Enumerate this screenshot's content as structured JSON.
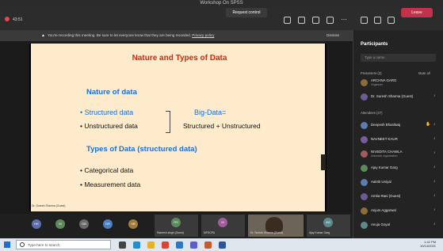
{
  "window": {
    "title": "Workshop On SPSS"
  },
  "toolbar": {
    "timer": "43:51",
    "request_control": "Request control",
    "leave": "Leave"
  },
  "banner": {
    "message": "You're recording this meeting. Be sure to let everyone know that they are being recorded.",
    "privacy_link": "Privacy policy",
    "dismiss": "Dismiss"
  },
  "slide": {
    "title": "Nature and Types of Data",
    "nature_heading": "Nature of data",
    "bullet_structured": "• Structured data",
    "bullet_unstructured": "• Unstructured data",
    "bigdata_label": "Big-Data=",
    "bigdata_formula": "Structured + Unstructured",
    "types_heading": "Types of Data (structured data)",
    "bullet_categorical": "• Categorical data",
    "bullet_measurement": "• Measurement data",
    "speaker_tag": "Dr. Suresh Sharma (Guest)"
  },
  "participants_panel": {
    "title": "Participants",
    "search_placeholder": "Type a name",
    "presenters_header": "Presenters (2)",
    "mute_all": "Mute all",
    "attendees_header": "Attendees (47)",
    "presenters": [
      {
        "initials": "AS",
        "name": "ARCHNA GARG",
        "sub": "Organizer",
        "color": "#8a6d3b"
      },
      {
        "initials": "DS",
        "name": "Dr. Suresh Sharma (Guest)",
        "sub": "",
        "color": "#6b5b95"
      }
    ],
    "attendees": [
      {
        "initials": "DB",
        "name": "Deepesh Bhardwaj",
        "sub": "",
        "color": "#5b7db1"
      },
      {
        "initials": "NK",
        "name": "NAVNEET KAUR",
        "sub": "",
        "color": "#7a5c9e"
      },
      {
        "initials": "NC",
        "name": "NIVEDITA CHAWLA",
        "sub": "Unknown organization",
        "color": "#a05c5c"
      },
      {
        "initials": "AG",
        "name": "Ajay Kumar Garg",
        "sub": "",
        "color": "#5c8a5c"
      },
      {
        "initials": "AU",
        "name": "Aakriti Uniyal",
        "sub": "",
        "color": "#5b7db1"
      },
      {
        "initials": "AR",
        "name": "Amita Rani (Guest)",
        "sub": "",
        "color": "#6b5b95"
      },
      {
        "initials": "AA",
        "name": "Anjum Aggarwal",
        "sub": "",
        "color": "#8a6d3b"
      },
      {
        "initials": "AG",
        "name": "Anuja Goyal",
        "sub": "",
        "color": "#5c8a8a"
      }
    ]
  },
  "bottom_strip": {
    "avatars": [
      {
        "initials": "HK",
        "color": "#5b6fb1"
      },
      {
        "initials": "M",
        "color": "#5c8a5c"
      },
      {
        "initials": "DB",
        "color": "#6a6a6a"
      },
      {
        "initials": "DR",
        "color": "#4d7fbf"
      },
      {
        "initials": "VB",
        "color": "#a07b3c"
      }
    ],
    "tiles": [
      {
        "initials": "RS",
        "label": "Ramesh singh (Guest)",
        "color": "#5c8a5c"
      },
      {
        "initials": "M",
        "label": "MFDCPA",
        "color": "#a05c9e"
      },
      {
        "initials": "",
        "label": "Dr. Suresh Sharma (Guest)",
        "color": "#8a6d3b"
      },
      {
        "initials": "AG",
        "label": "Ajay Kumar Garg",
        "color": "#5c8a8a"
      }
    ]
  },
  "taskbar": {
    "search_placeholder": "Type here to search",
    "time": "1:42 PM",
    "date": "10/14/2021"
  }
}
